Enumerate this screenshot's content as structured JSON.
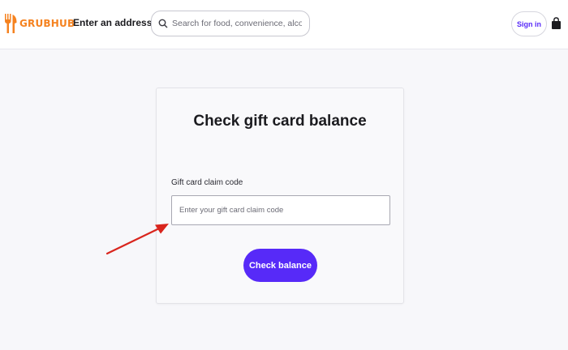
{
  "header": {
    "logo_text": "GRUBHUB",
    "address_label": "Enter an address",
    "search": {
      "placeholder": "Search for food, convenience, alcohol...",
      "value": ""
    },
    "signin_label": "Sign in"
  },
  "card": {
    "title": "Check gift card balance",
    "field_label": "Gift card claim code",
    "input": {
      "placeholder": "Enter your gift card claim code",
      "value": ""
    },
    "button_label": "Check balance"
  },
  "colors": {
    "brand_orange": "#f5821f",
    "accent_purple": "#572af8",
    "annotation_red": "#d9251d"
  },
  "icons": {
    "logo": "grubhub-logo-icon",
    "address": "chevron-down-icon",
    "search": "search-icon",
    "cart": "shopping-bag-icon",
    "annotation": "red-arrow-annotation"
  }
}
